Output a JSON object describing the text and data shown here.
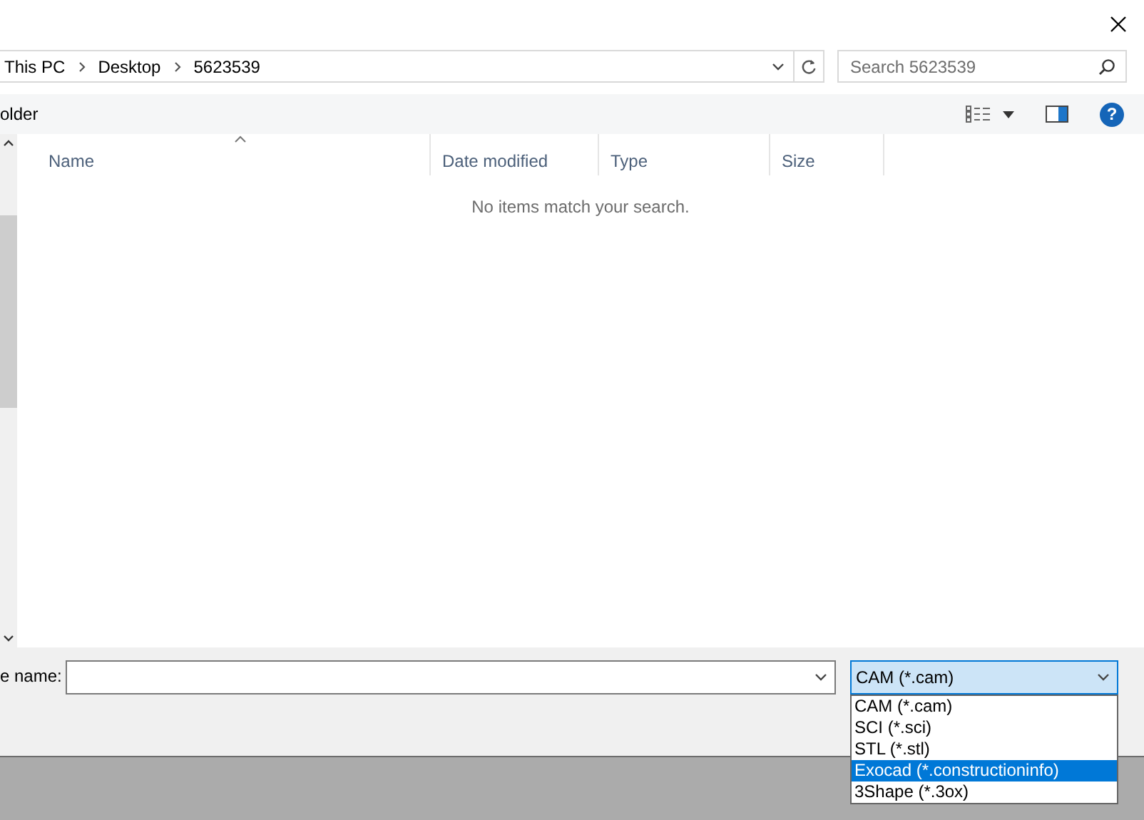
{
  "breadcrumbs": [
    {
      "label": "This PC"
    },
    {
      "label": "Desktop"
    },
    {
      "label": "5623539"
    }
  ],
  "search": {
    "placeholder": "Search 5623539"
  },
  "toolbar": {
    "label": "older",
    "help": "?"
  },
  "columns": [
    {
      "label": "Name",
      "sorted": true
    },
    {
      "label": "Date modified",
      "sorted": false
    },
    {
      "label": "Type",
      "sorted": false
    },
    {
      "label": "Size",
      "sorted": false
    }
  ],
  "empty_message": "No items match your search.",
  "file_name": {
    "label": "e name:"
  },
  "file_type": {
    "value": "CAM (*.cam)",
    "expanded": true,
    "options": [
      {
        "label": "CAM (*.cam)",
        "highlighted": false
      },
      {
        "label": "SCI (*.sci)",
        "highlighted": false
      },
      {
        "label": "STL (*.stl)",
        "highlighted": false
      },
      {
        "label": "Exocad (*.constructioninfo)",
        "highlighted": true
      },
      {
        "label": "3Shape (*.3ox)",
        "highlighted": false
      }
    ]
  }
}
